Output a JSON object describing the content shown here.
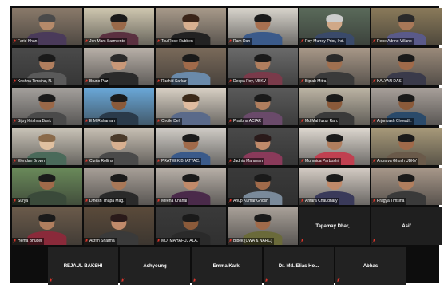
{
  "grid": {
    "row1": [
      {
        "name": "Farid Khan",
        "bg": "#8a7a6a",
        "skin": "#b58a6a",
        "hair": "#4a4a4a",
        "shirt": "#4a3a5a"
      },
      {
        "name": "Jon Mars Sarmiento",
        "bg": "#cfc7b0",
        "skin": "#9a6a4a",
        "hair": "#1a1a1a",
        "shirt": "#5a3040"
      },
      {
        "name": "Tsu Rose Rubben",
        "bg": "#a89a8a",
        "skin": "#d8b090",
        "hair": "#3a2418",
        "shirt": "#222222"
      },
      {
        "name": "Ram Dan",
        "bg": "#d8d4cc",
        "skin": "#a87050",
        "hair": "#1a1a1a",
        "shirt": "#3a5a8a"
      },
      {
        "name": "Roy Murray-Prior, Ind.",
        "bg": "#5a6a5a",
        "skin": "#d0a888",
        "hair": "#cccccc",
        "shirt": "#3a4a6a"
      },
      {
        "name": "Rene Adrino Villano",
        "bg": "#8a7a5a",
        "skin": "#a87858",
        "hair": "#2a2a2a",
        "shirt": "#5a5a8a"
      }
    ],
    "row2": [
      {
        "name": "Krishna Timsina, N.",
        "bg": "#4a4a4a",
        "skin": "#b07e5e",
        "hair": "#1a1a1a",
        "shirt": "#5a5a5a"
      },
      {
        "name": "Bruno Paz",
        "bg": "#b8b0a8",
        "skin": "#c89878",
        "hair": "#2a2a2a",
        "shirt": "#2a2a2a"
      },
      {
        "name": "Rashid Sarkar",
        "bg": "#7a6a5a",
        "skin": "#a06a4a",
        "hair": "#1a1a1a",
        "shirt": "#6a8aaa"
      },
      {
        "name": "Deepa Roy, UBKV",
        "bg": "#6a6a6a",
        "skin": "#b07e5e",
        "hair": "#1a1a1a",
        "shirt": "#7a3a4a"
      },
      {
        "name": "Biplab Mitra",
        "bg": "#a89888",
        "skin": "#a07050",
        "hair": "#2a2a2a",
        "shirt": "#3a3a3a"
      },
      {
        "name": "KALYAN DAS",
        "bg": "#9a8a7a",
        "skin": "#a06a4a",
        "hair": "#1a1a1a",
        "shirt": "#3a3a4a"
      }
    ],
    "row3": [
      {
        "name": "Bijoy Krishna Bank",
        "bg": "#a4a09c",
        "skin": "#9a6848",
        "hair": "#1a1a1a",
        "shirt": "#4a4a4a"
      },
      {
        "name": "E M Rahaman",
        "bg": "#6aa8d8",
        "skin": "#8a5a3a",
        "hair": "#1a1a1a",
        "shirt": "#2a3a4a"
      },
      {
        "name": "Cecile Dell",
        "bg": "#d8d0c4",
        "skin": "#e0bca0",
        "hair": "#3a2818",
        "shirt": "#5a6a8a"
      },
      {
        "name": "Pratibha ACIAR",
        "bg": "#5a5a5a",
        "skin": "#b07e5e",
        "hair": "#1a1a1a",
        "shirt": "#6a4a6a"
      },
      {
        "name": "Md Mahfuzur Rah.",
        "bg": "#bcb4a4",
        "skin": "#8a5a3a",
        "hair": "#1a1a1a",
        "shirt": "#3a3a3a"
      },
      {
        "name": "Arjunbash Chowdh.",
        "bg": "#a8a09a",
        "skin": "#8a5a3a",
        "hair": "#1a1a1a",
        "shirt": "#2a4a6a"
      }
    ],
    "row4": [
      {
        "name": "Elendan Brown",
        "bg": "#cac4b8",
        "skin": "#e0c0a0",
        "hair": "#8a6a4a",
        "shirt": "#4a6a5a"
      },
      {
        "name": "Curtis Rollins",
        "bg": "#c8c0b4",
        "skin": "#d8b090",
        "hair": "#4a3a2a",
        "shirt": "#4a4a4a"
      },
      {
        "name": "PRATEEK BHATTAC.",
        "bg": "#d0ccc6",
        "skin": "#a06a4a",
        "hair": "#1a1a1a",
        "shirt": "#3a5a8a"
      },
      {
        "name": "Jadhia Mahanan",
        "bg": "#4a4a4a",
        "skin": "#c08a6a",
        "hair": "#2a1a1a",
        "shirt": "#8a3a5a"
      },
      {
        "name": "Munmida Parboshi.",
        "bg": "#ded8d0",
        "skin": "#b07e5e",
        "hair": "#1a1a1a",
        "shirt": "#c04050"
      },
      {
        "name": "Arunava Ghosh UBKV",
        "bg": "#a89a7a",
        "skin": "#a06a4a",
        "hair": "#1a1a1a",
        "shirt": "#6a5a4a"
      }
    ],
    "row5": [
      {
        "name": "Surya",
        "bg": "#6a8a5a",
        "skin": "#a06a4a",
        "hair": "#1a1a1a",
        "shirt": "#3a4a3a"
      },
      {
        "name": "Dinesh Thapa Mag.",
        "bg": "#a8a098",
        "skin": "#a87858",
        "hair": "#1a1a1a",
        "shirt": "#2a2a2a"
      },
      {
        "name": "Meena Khanal",
        "bg": "#b8b0a8",
        "skin": "#c08a6a",
        "hair": "#1a1a1a",
        "shirt": "#4a2a4a"
      },
      {
        "name": "Anup Kumar Ghosh",
        "bg": "#3a3a3a",
        "skin": "#a06a4a",
        "hair": "#1a1a1a",
        "shirt": "#7a8a9a"
      },
      {
        "name": "Antara Chaudhary",
        "bg": "#d4ccc4",
        "skin": "#c08a6a",
        "hair": "#1a1a1a",
        "shirt": "#3a3a5a"
      },
      {
        "name": "Pragya Timsina",
        "bg": "#a8988a",
        "skin": "#b07e5e",
        "hair": "#1a1a1a",
        "shirt": "#3a3a3a"
      }
    ],
    "row6": [
      {
        "name": "Hema Bhuder",
        "bg": "#6a5a4a",
        "skin": "#b07e5e",
        "hair": "#1a1a1a",
        "shirt": "#8a2a3a",
        "kind": "video"
      },
      {
        "name": "Akrith Sharma",
        "bg": "#5a4a3a",
        "skin": "#c08a6a",
        "hair": "#2a1a1a",
        "shirt": "#3a3a3a",
        "kind": "video"
      },
      {
        "name": "MD. MAHAFUJ ALA.",
        "bg": "#3a3a3a",
        "skin": "#8a5a3a",
        "hair": "#1a1a1a",
        "shirt": "#2a2a2a",
        "kind": "video"
      },
      {
        "name": "Bibek (UWA & NARC)",
        "bg": "#a8a098",
        "skin": "#a06a4a",
        "hair": "#1a1a1a",
        "shirt": "#6a6a3a",
        "kind": "video"
      },
      {
        "name": "Tapamay  Dhar,...",
        "kind": "text"
      },
      {
        "name": "Asif",
        "kind": "text"
      }
    ],
    "bottom_row": [
      "REJAUL BAKSHI",
      "Achyoung",
      "Emma Karki",
      "Dr. Md. Elias Ho...",
      "Abhas"
    ]
  },
  "colors": {
    "active_speaker": "#f2d33a",
    "mic_muted": "#e0352b",
    "tile_dark": "#1f1f1f"
  },
  "active_speaker_index": "row1.5"
}
